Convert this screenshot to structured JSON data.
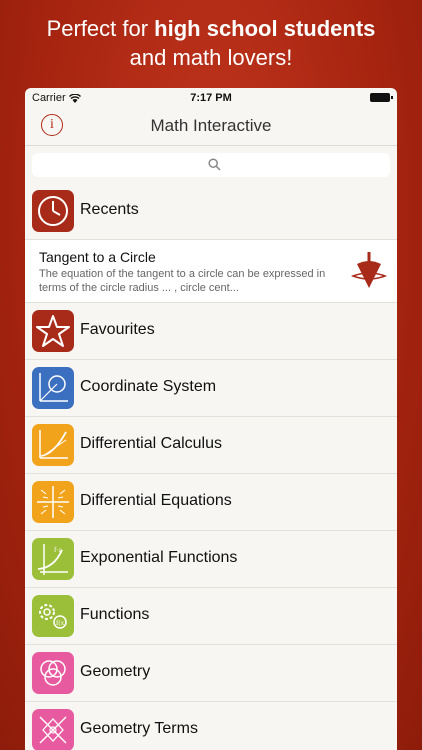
{
  "promo": {
    "line1_prefix": "Perfect for ",
    "line1_bold": "high school students",
    "line2": "and math lovers!"
  },
  "status": {
    "carrier": "Carrier",
    "time": "7:17 PM"
  },
  "nav": {
    "title": "Math Interactive",
    "info_icon": "info-icon"
  },
  "search": {
    "placeholder": ""
  },
  "recent_item": {
    "title": "Tangent to a Circle",
    "desc": "The equation of the tangent to a circle can be expressed in terms of the circle radius ... , circle cent..."
  },
  "rows": [
    {
      "label": "Recents",
      "color": "#a82a18",
      "icon": "clock-icon"
    },
    {
      "label": "Favourites",
      "color": "#a82a18",
      "icon": "star-icon"
    },
    {
      "label": "Coordinate System",
      "color": "#3b6fc0",
      "icon": "coordinate-icon"
    },
    {
      "label": "Differential Calculus",
      "color": "#f2a31c",
      "icon": "calculus-icon"
    },
    {
      "label": "Differential Equations",
      "color": "#f2a31c",
      "icon": "field-icon"
    },
    {
      "label": "Exponential Functions",
      "color": "#9cbf3a",
      "icon": "exponential-icon"
    },
    {
      "label": "Functions",
      "color": "#9cbf3a",
      "icon": "gears-icon"
    },
    {
      "label": "Geometry",
      "color": "#e75a9f",
      "icon": "circles-icon"
    },
    {
      "label": "Geometry Terms",
      "color": "#e75a9f",
      "icon": "geometry-terms-icon"
    }
  ]
}
